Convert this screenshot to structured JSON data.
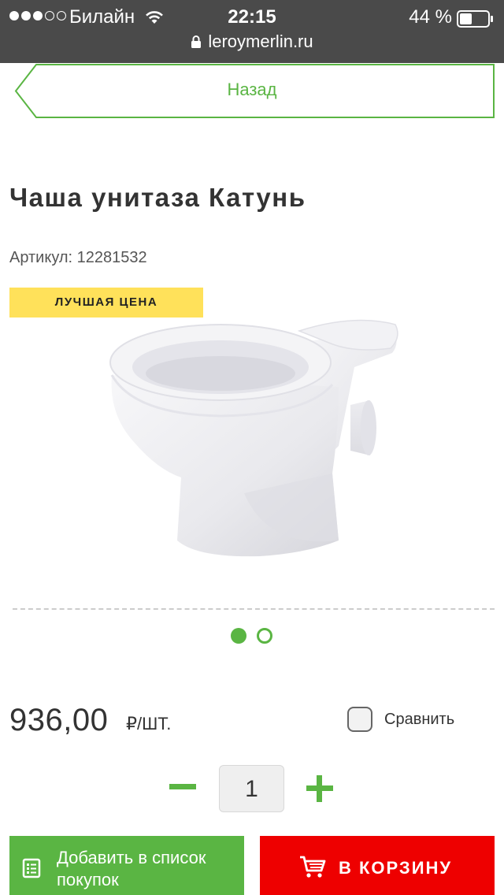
{
  "status_bar": {
    "carrier": "Билайн",
    "time": "22:15",
    "battery": "44 %",
    "url": "leroymerlin.ru",
    "signal_bars_filled": 3,
    "signal_bars_total": 5,
    "battery_level": 0.44
  },
  "nav": {
    "back_label": "Назад"
  },
  "product": {
    "title": "Чаша унитаза Катунь",
    "sku": "Артикул: 12281532",
    "badge": "ЛУЧШАЯ ЦЕНА",
    "image_alt": "toilet-bowl-image",
    "gallery_total": 2,
    "gallery_active": 1
  },
  "pricing": {
    "price": "936,00",
    "unit": "₽/ШТ."
  },
  "compare": {
    "label": "Сравнить",
    "checked": false
  },
  "quantity": {
    "value": "1"
  },
  "actions": {
    "add_to_list_label": "Добавить в список покупок",
    "add_to_cart_label": "В КОРЗИНУ"
  },
  "icons": {
    "wifi": "wifi-icon",
    "battery": "battery-icon",
    "lock": "lock-icon",
    "list": "shopping-list-icon",
    "cart": "cart-icon"
  },
  "colors": {
    "accent_green": "#5ab543",
    "cart_red": "#ee0000",
    "badge_yellow": "#ffe15a",
    "status_bar_bg": "#4a4a4a"
  }
}
